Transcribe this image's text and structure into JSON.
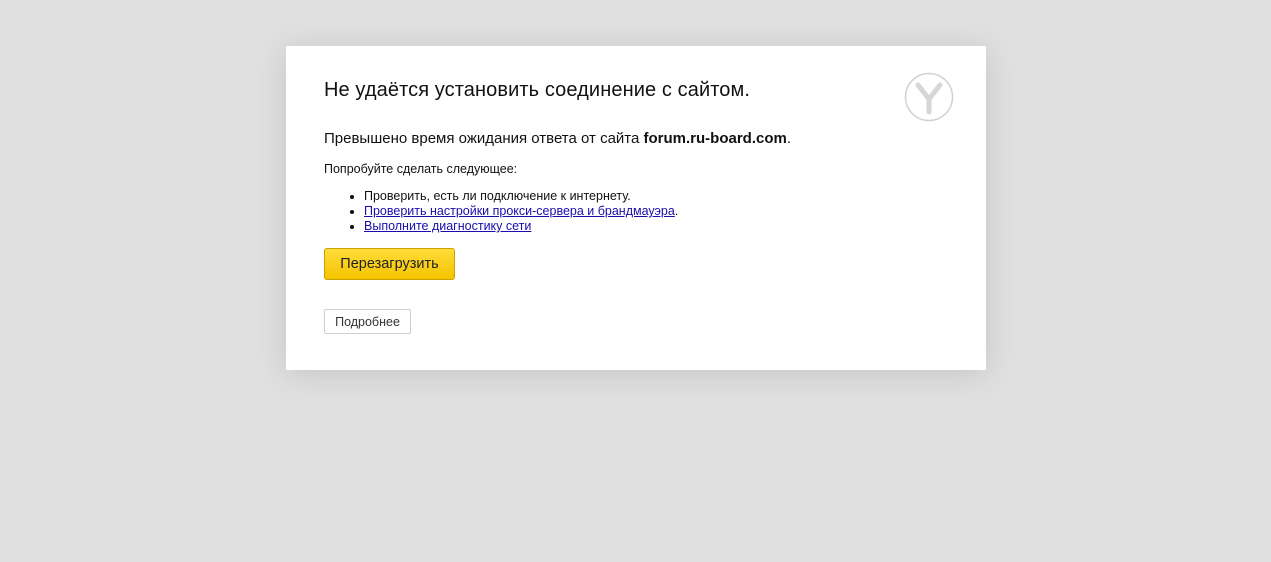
{
  "error": {
    "title": "Не удаётся установить соединение с сайтом.",
    "description_prefix": "Превышено время ожидания ответа от сайта",
    "site": "forum.ru-board.com",
    "description_suffix": ".",
    "try_label": "Попробуйте сделать следующее:",
    "suggestions": {
      "check_connection": "Проверить, есть ли подключение к интернету.",
      "check_proxy_link": "Проверить настройки прокси-сервера и брандмауэра",
      "check_proxy_suffix": ".",
      "run_diagnostics_link": "Выполните диагностику сети"
    },
    "reload_label": "Перезагрузить",
    "details_label": "Подробнее"
  },
  "icons": {
    "logo": "yandex-browser-logo-icon"
  },
  "colors": {
    "background": "#e0e0e0",
    "card": "#ffffff",
    "reload_button": "#ffd42b",
    "link": "#1a0dab"
  }
}
